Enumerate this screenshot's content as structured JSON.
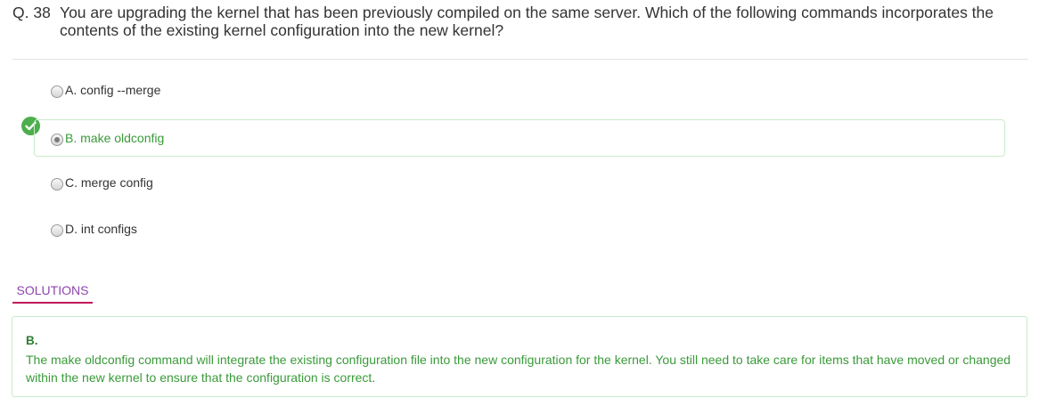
{
  "question": {
    "number": "Q. 38",
    "text": "You are upgrading the kernel that has been previously compiled on the same server. Which of the following commands incorporates the contents of the existing kernel configuration into the new kernel?"
  },
  "options": [
    {
      "label": "A. config --merge",
      "selected": false,
      "correct": false
    },
    {
      "label": "B. make oldconfig",
      "selected": true,
      "correct": true
    },
    {
      "label": "C. merge config",
      "selected": false,
      "correct": false
    },
    {
      "label": "D. int configs",
      "selected": false,
      "correct": false
    }
  ],
  "solutions": {
    "tab_label": "SOLUTIONS",
    "answer": "B.",
    "explanation": "The make oldconfig command will integrate the existing configuration file into the new configuration for the kernel. You still need to take care for items that have moved or changed within the new kernel to ensure that the configuration is correct."
  },
  "colors": {
    "correct_green": "#3a9a3a",
    "badge_green": "#4cae4c",
    "tab_underline": "#c2185b",
    "tab_text": "#8e44ad"
  },
  "icons": {
    "correct_badge": "check-circle-icon"
  }
}
